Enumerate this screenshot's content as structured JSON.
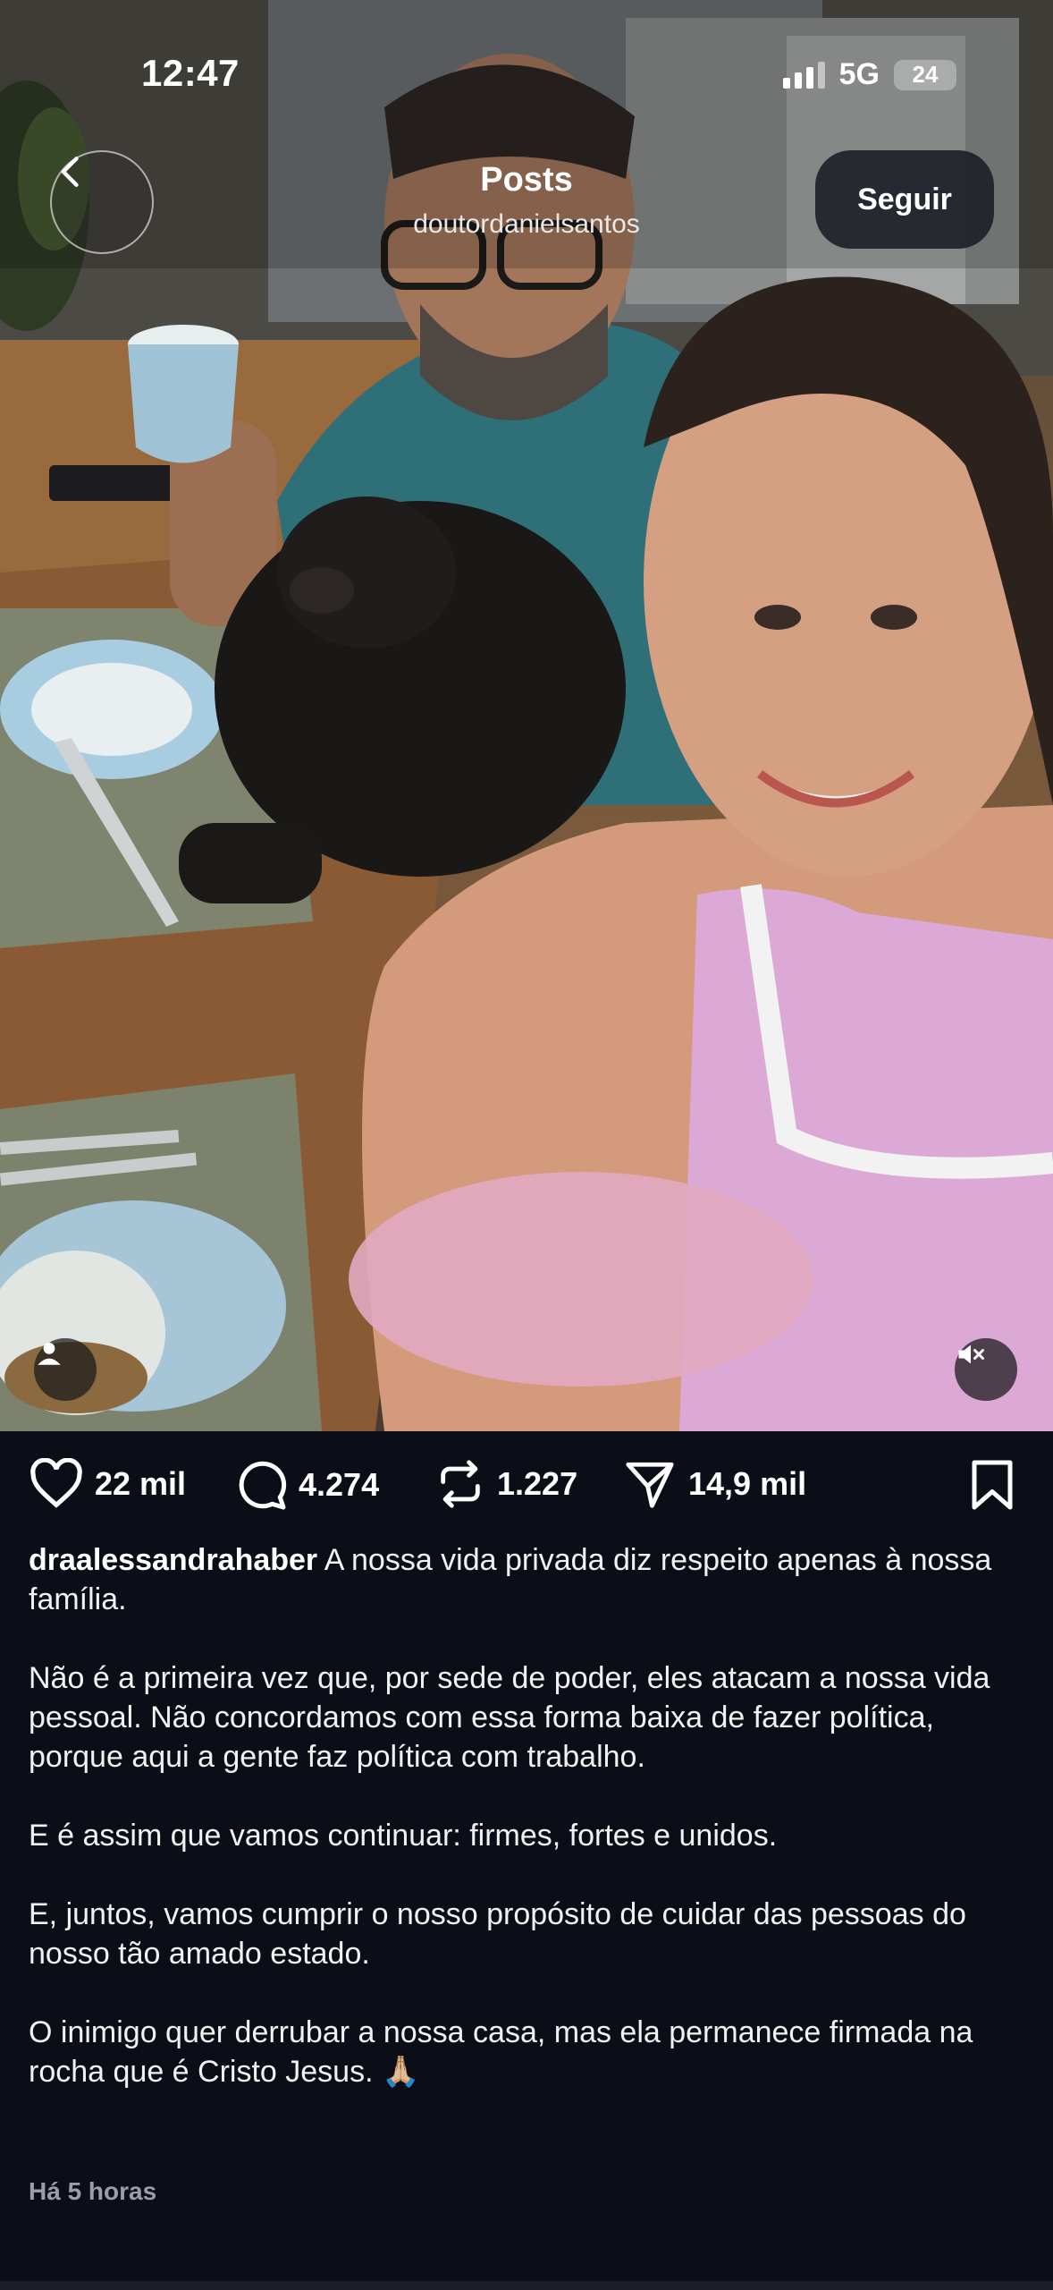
{
  "status_bar": {
    "time": "12:47",
    "network": "5G",
    "battery": "24"
  },
  "header": {
    "title": "Posts",
    "username": "doutordanielsantos",
    "follow_label": "Seguir"
  },
  "actions": {
    "likes": "22 mil",
    "comments": "4.274",
    "reposts": "1.227",
    "shares": "14,9 mil"
  },
  "caption": {
    "author": "draalessandrahaber",
    "paragraph_1": "A nossa vida privada diz respeito apenas à nossa família.",
    "paragraph_2": "Não é a primeira vez que, por sede de poder, eles atacam a nossa vida pessoal. Não concordamos com essa forma baixa de fazer política, porque aqui a gente faz política com trabalho.",
    "paragraph_3": "E é assim que vamos continuar: firmes, fortes e unidos.",
    "paragraph_4": "E, juntos, vamos cumprir o nosso propósito de cuidar das pessoas do nosso tão amado estado.",
    "paragraph_5": "O inimigo quer derrubar a nossa casa, mas ela permanece firmada na rocha que é Cristo Jesus.",
    "emoji": "🙏🏼"
  },
  "time_ago": "Há 5 horas",
  "icons": {
    "back": "chevron-left-icon",
    "tag": "user-tag-icon",
    "mute": "speaker-muted-icon",
    "like": "heart-icon",
    "comment": "comment-bubble-icon",
    "repost": "repost-icon",
    "share": "send-icon",
    "save": "bookmark-icon"
  },
  "colors": {
    "background": "#0b0e16",
    "text": "#ffffff",
    "secondary_text": "#9a9ea8"
  }
}
